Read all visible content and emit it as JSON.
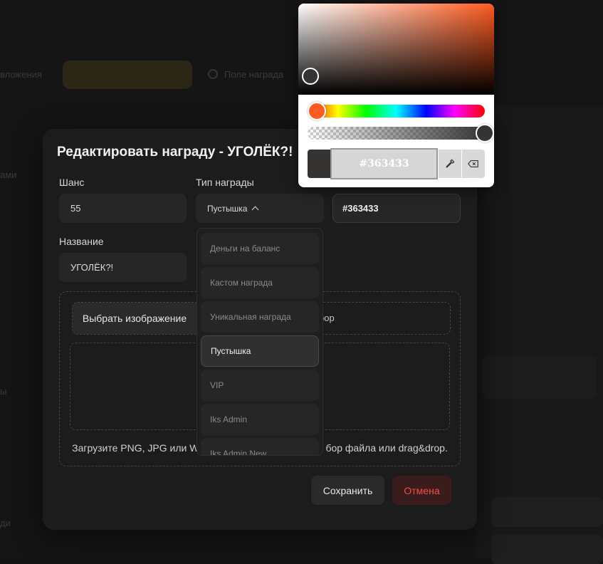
{
  "background": {
    "fragments": [
      "вложения",
      "Поле награда",
      "ами",
      "ы",
      "ди"
    ]
  },
  "modal": {
    "title": "Редактировать награду - УГОЛЁК?!",
    "chance": {
      "label": "Шанс",
      "value": "55"
    },
    "reward_type": {
      "label": "Тип награды",
      "selected": "Пустышка"
    },
    "color": {
      "value": "#363433"
    },
    "name": {
      "label": "Название",
      "value": "УГОЛЁК?!"
    },
    "upload": {
      "choose_label": "Выбрать изображение",
      "file_hint": "pop",
      "hint_left": "Загрузите PNG, JPG или W",
      "hint_right": "бор файла или drag&drop."
    },
    "save_label": "Сохранить",
    "cancel_label": "Отмена"
  },
  "dropdown": {
    "options": [
      "Деньги на баланс",
      "Кастом награда",
      "Уникальная награда",
      "Пустышка",
      "VIP",
      "Iks Admin",
      "Iks Admin New"
    ],
    "selected_index": 3
  },
  "color_picker": {
    "hex": "#363433",
    "hue_color": "#ff5a1f",
    "alpha_percent": 100,
    "eyedropper_icon": "eyedropper-icon",
    "clear_icon": "backspace-icon"
  }
}
